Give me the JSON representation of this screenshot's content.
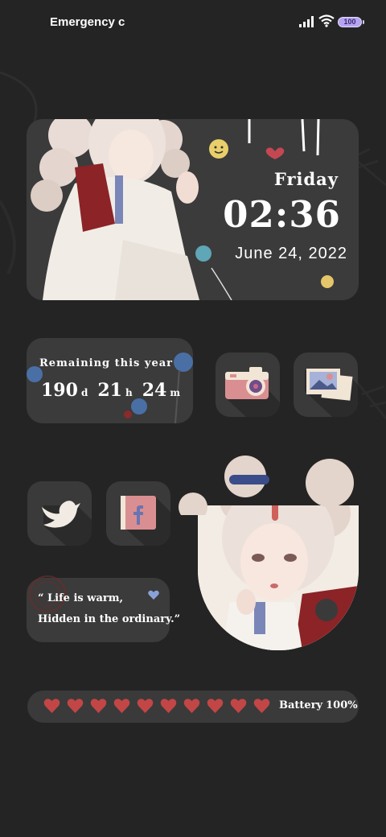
{
  "status_bar": {
    "carrier_text": "Emergency c",
    "battery_level": "100"
  },
  "clock_widget": {
    "day": "Friday",
    "time": "02:36",
    "date": "June  24,  2022"
  },
  "remaining_widget": {
    "title": "Remaining this year",
    "days": "190",
    "days_unit": "d",
    "hours": "21",
    "hours_unit": "h",
    "minutes": "24",
    "minutes_unit": "m"
  },
  "apps": [
    {
      "name": "camera",
      "icon": "camera-icon"
    },
    {
      "name": "gallery",
      "icon": "gallery-icon"
    },
    {
      "name": "twitter",
      "icon": "twitter-bird-icon"
    },
    {
      "name": "facebook",
      "icon": "facebook-icon"
    }
  ],
  "quote_widget": {
    "line1": "“ Life is warm,",
    "line2": "Hidden in the ordinary.”"
  },
  "battery_widget": {
    "label": "Battery",
    "value": "100%",
    "hearts_count": 10,
    "heart_color": "#c24646"
  },
  "colors": {
    "background": "#242424",
    "widget": "#3b3b3b",
    "accent_red": "#c24646",
    "battery_pill": "#b6a3f2"
  }
}
